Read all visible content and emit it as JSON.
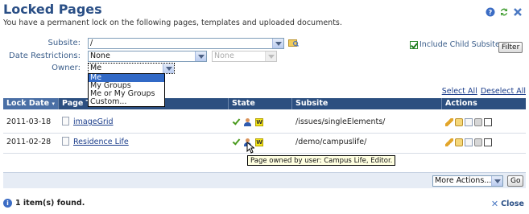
{
  "header": {
    "title": "Locked Pages",
    "subtitle": "You have a permanent lock on the following pages, templates and uploaded documents.",
    "icons": [
      "help-icon",
      "refresh-icon",
      "close-icon"
    ]
  },
  "filters": {
    "subsite_label": "Subsite:",
    "subsite_value": "/",
    "date_label": "Date Restrictions:",
    "date_value": "None",
    "date_secondary_value": "None",
    "owner_label": "Owner:",
    "owner_value": "Me",
    "owner_options": [
      "Me",
      "My Groups",
      "Me or My Groups",
      "Custom..."
    ],
    "include_child_label": "Include Child Subsites",
    "include_child_checked": true,
    "filter_button": "Filter"
  },
  "links": {
    "select_all": "Select All",
    "deselect_all": "Deselect All"
  },
  "table": {
    "columns": [
      "Lock Date",
      "Page Title",
      "State",
      "Subsite",
      "Actions"
    ],
    "rows": [
      {
        "lock_date": "2011-03-18",
        "title": "imageGrid",
        "subsite": "/issues/singleElements/",
        "state_badge": "W"
      },
      {
        "lock_date": "2011-02-28",
        "title": "Residence Life",
        "subsite": "/demo/campuslife/",
        "state_badge": "W"
      }
    ]
  },
  "tooltip": "Page owned by user: Campus Life, Editor.",
  "footer": {
    "more_actions": "More Actions...",
    "go_button": "Go",
    "status": "1 item(s) found.",
    "close": "Close"
  }
}
